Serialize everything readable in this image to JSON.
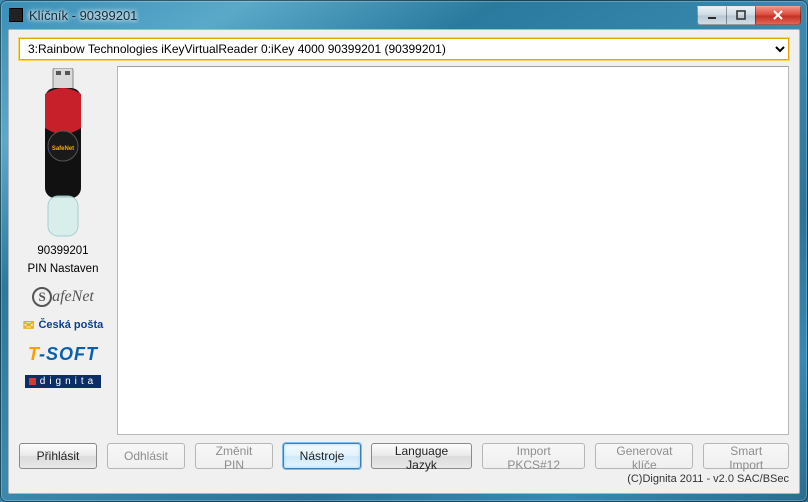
{
  "window": {
    "title": "Klíčník - 90399201"
  },
  "reader": {
    "selected": "3:Rainbow Technologies iKeyVirtualReader 0:iKey 4000 90399201 (90399201)"
  },
  "device": {
    "serial": "90399201",
    "pin_status": "PIN Nastaven"
  },
  "logos": {
    "safenet": "afeNet",
    "ceskaposta": "Česká pošta",
    "tsoft_t": "T",
    "tsoft_soft": "-SOFT",
    "dignita": "dignita"
  },
  "buttons": {
    "login": "Přihlásit",
    "logout": "Odhlásit",
    "change_pin": "Změnit PIN",
    "tools": "Nástroje",
    "language": "Language Jazyk",
    "import_pkcs12": "Import PKCS#12",
    "gen_keys": "Generovat klíče",
    "smart_import": "Smart Import"
  },
  "status": {
    "copyright": "(C)Dignita 2011 - v2.0 SAC/BSec"
  }
}
